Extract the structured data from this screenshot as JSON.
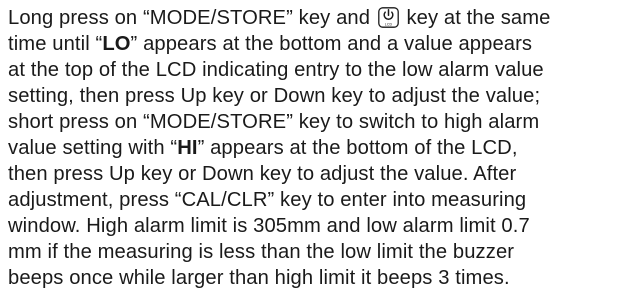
{
  "paragraph": {
    "l1_a": "Long press on “MODE/STORE” key and ",
    "l1_b": " key at the same",
    "lcd_key": {
      "label": "LCD",
      "icon": "power-icon"
    },
    "l2_a": "time until “",
    "l2_bold": "LO",
    "l2_b": "” appears at the bottom and a value appears",
    "l3": "at the top of the LCD indicating entry to the low alarm value",
    "l4": "setting, then press Up key or Down key to adjust the value;",
    "l5": "short press on “MODE/STORE” key to switch to high alarm",
    "l6_a": "value setting with “",
    "l6_bold": "HI",
    "l6_b": "” appears at the bottom of the LCD,",
    "l7": "then press Up key or Down key to adjust the value. After",
    "l8": "adjustment, press “CAL/CLR” key to enter into measuring",
    "l9": "window. High alarm limit is 305mm and low alarm limit 0.7",
    "l10": "mm if the measuring is less than the low limit the buzzer",
    "l11": "beeps once while larger than high limit it beeps 3 times."
  }
}
